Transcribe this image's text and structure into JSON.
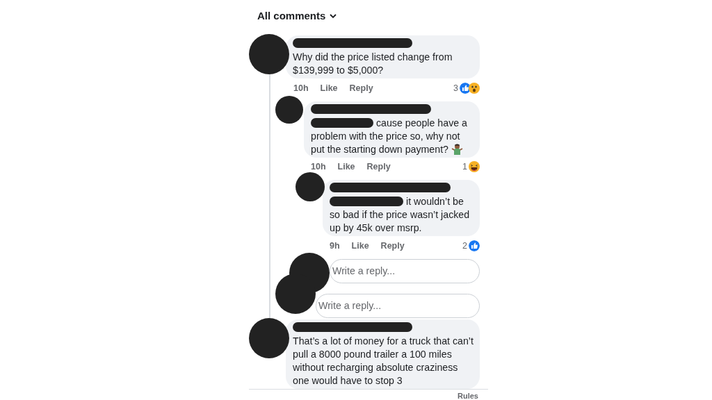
{
  "header": {
    "label": "All comments"
  },
  "comments": [
    {
      "text": "Why did the price listed change from $139,999 to $5,000?",
      "time": "10h",
      "like": "Like",
      "reply": "Reply",
      "reaction_count": "3",
      "reactions": [
        {
          "kind": "like"
        },
        {
          "kind": "wow"
        }
      ],
      "replies": [
        {
          "mention": true,
          "text": "cause people have a problem with the price so, why not put the starting down payment?",
          "emoji": {
            "kind": "shrug"
          },
          "time": "10h",
          "like": "Like",
          "reply": "Reply",
          "reaction_count": "1",
          "reactions": [
            {
              "kind": "haha"
            }
          ],
          "replies": [
            {
              "mention": true,
              "text": "it wouldn’t be so bad if the price wasn’t jacked up by 45k over msrp.",
              "time": "9h",
              "like": "Like",
              "reply": "Reply",
              "reaction_count": "2",
              "reactions": [
                {
                  "kind": "like"
                }
              ]
            }
          ],
          "reply_field": {
            "placeholder": "Write a reply..."
          }
        }
      ],
      "reply_field": {
        "placeholder": "Write a reply..."
      }
    },
    {
      "text": "That’s a lot of money for a truck that can’t pull a 8000 pound trailer a 100 miles without recharging  absolute craziness one would have to stop 3"
    }
  ],
  "footer": {
    "link": "Rules"
  }
}
